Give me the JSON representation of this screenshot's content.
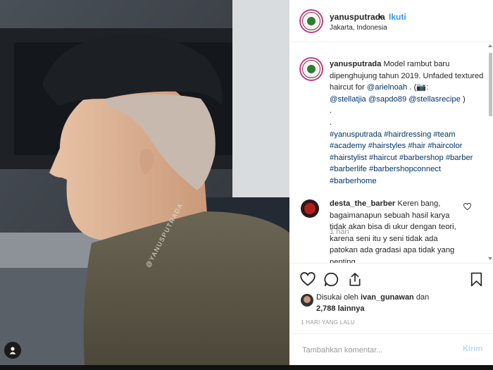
{
  "photo": {
    "watermark": "@YANUSPUTRADA"
  },
  "header": {
    "username": "yanusputrada",
    "separator": "•",
    "follow_label": "Ikuti",
    "location": "Jakarta, Indonesia"
  },
  "caption": {
    "username": "yanusputrada",
    "text_main": "Model rambut baru dipenghujung tahun 2019. Unfaded textured haircut for ",
    "mention_ariel": "@arielnoah",
    "text_credit": " . (📷: ",
    "mention_1": "@stellatjia",
    "mention_2": "@sapdo89",
    "mention_3": "@stellasrecipe",
    "text_close": " )",
    "dot_1": ".",
    "dot_2": ".",
    "hashtags": [
      "#yanusputrada",
      "#hairdressing",
      "#team",
      "#academy",
      "#hairstyles",
      "#hair",
      "#haircolor",
      "#hairstylist",
      "#haircut",
      "#barbershop",
      "#barber",
      "#barberlife",
      "#barbershopconnect",
      "#barberhome"
    ],
    "time": "1 hari"
  },
  "comment": {
    "username": "desta_the_barber",
    "text": "Keren bang, bagaimanapun sebuah hasil karya tidak akan bisa di ukur dengan teori, karena seni itu y seni tidak ada patokan ada gradasi apa tidak yang penting"
  },
  "likes": {
    "line1_prefix": "Disukai oleh ",
    "liker": "ivan_gunawan",
    "line1_suffix": " dan",
    "count": "2,788",
    "count_suffix": " lainnya"
  },
  "posted_time": "1 HARI YANG LALU",
  "add_comment": {
    "placeholder": "Tambahkan komentar...",
    "send_label": "Kirim"
  },
  "icons": {
    "like": "heart-icon",
    "comment": "comment-icon",
    "share": "share-icon",
    "save": "bookmark-icon",
    "tag": "user-tag-icon"
  },
  "colors": {
    "link": "#003569",
    "follow": "#3897f0",
    "send_disabled": "#b3dbff",
    "muted": "#999999"
  }
}
